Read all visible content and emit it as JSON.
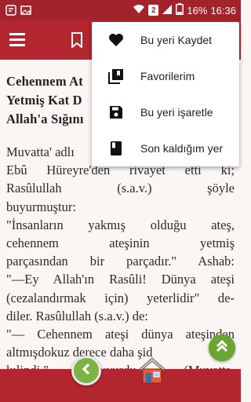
{
  "status_bar": {
    "sim_label": "2",
    "battery": "16%",
    "time": "16:36",
    "icons": [
      "notification-icon",
      "image-icon",
      "wifi-icon",
      "signal-icon",
      "battery-icon"
    ]
  },
  "app_bar": {
    "icons": [
      "menu-icon",
      "bookmark-icon"
    ]
  },
  "content": {
    "title_lines": [
      "Cehennem At",
      "Yetmiş Kat D",
      "Allah'a Sığını"
    ],
    "body_lines": [
      "Muvatta' adlı",
      "Ebû Hüreyre'den rivayet etti ki;",
      "Rasûlullah       (s.a.v.)       şöyle",
      "buyurmuştur:",
      "\"İnsanların   yakmış   olduğu   ateş,",
      "cehennem     ateşinin     yetmiş",
      "parçasından bir parçadır.\" Ashab:",
      "\"—Ey Allah'ın Rasûli! Dünya ateşi",
      "(cezalandırmak için) yeterlidir\" de-",
      "diler. Rasûlullah (s.a.v.) de:",
      "\"— Cehennem ateşi dünya ateşinden",
      "altmışdokuz derece daha şid",
      "kılindi.\"      buyurdu.      (Muvatta,"
    ]
  },
  "menu": {
    "items": [
      {
        "label": "Bu yeri Kaydet",
        "icon": "heart-icon"
      },
      {
        "label": "Favorilerim",
        "icon": "library-icon"
      },
      {
        "label": "Bu yeri işaretle",
        "icon": "save-icon"
      },
      {
        "label": "Son kaldığım yer",
        "icon": "book-icon"
      }
    ]
  },
  "bottom_bar": {
    "icons": [
      "back-icon",
      "home-icon",
      "scroll-up-icon"
    ]
  },
  "colors": {
    "primary": "#b3262f",
    "status_bar": "#a3232d",
    "accent_green": "#7cb342",
    "background": "#fbf6f4"
  }
}
